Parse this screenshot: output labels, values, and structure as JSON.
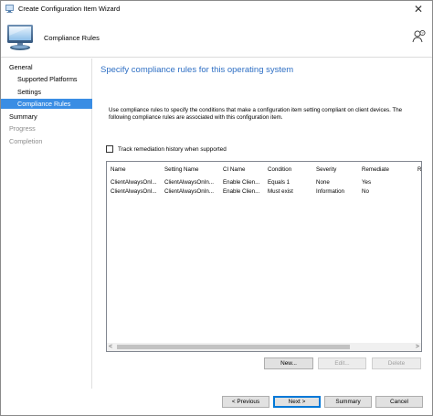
{
  "window": {
    "title": "Create Configuration Item Wizard",
    "close_glyph": "✕"
  },
  "header": {
    "title": "Compliance Rules",
    "icon": "computer-monitor-icon",
    "help_icon": "help-person-icon"
  },
  "sidebar": {
    "items": [
      {
        "label": "General",
        "level": 0,
        "state": "normal"
      },
      {
        "label": "Supported Platforms",
        "level": 1,
        "state": "normal"
      },
      {
        "label": "Settings",
        "level": 1,
        "state": "normal"
      },
      {
        "label": "Compliance Rules",
        "level": 1,
        "state": "selected"
      },
      {
        "label": "Summary",
        "level": 0,
        "state": "normal"
      },
      {
        "label": "Progress",
        "level": 0,
        "state": "disabled"
      },
      {
        "label": "Completion",
        "level": 0,
        "state": "disabled"
      }
    ]
  },
  "main": {
    "title": "Specify compliance rules for this operating system",
    "description": "Use compliance rules to specify the conditions that make a configuration item setting compliant on client devices. The following compliance rules are associated with this configuration item.",
    "track_history": {
      "label": "Track remediation history when supported",
      "checked": false
    }
  },
  "rules_table": {
    "columns": [
      "Name",
      "Setting Name",
      "CI Name",
      "Condition",
      "Severity",
      "Remediate",
      "R"
    ],
    "rows": [
      [
        "ClientAlwaysOnI...",
        "ClientAlwaysOnIn...",
        "Enable Clien...",
        "Equals 1",
        "None",
        "Yes"
      ],
      [
        "ClientAlwaysOnI...",
        "ClientAlwaysOnIn...",
        "Enable Clien...",
        "Must exist",
        "Information",
        "No"
      ]
    ],
    "scroll_left": "<",
    "scroll_right": ">"
  },
  "rule_buttons": {
    "new": "New...",
    "edit": "Edit...",
    "delete": "Delete"
  },
  "footer": {
    "previous": "< Previous",
    "next": "Next >",
    "summary": "Summary",
    "cancel": "Cancel"
  },
  "colors": {
    "accent": "#3a8de4",
    "title_blue": "#2e6fc4"
  }
}
